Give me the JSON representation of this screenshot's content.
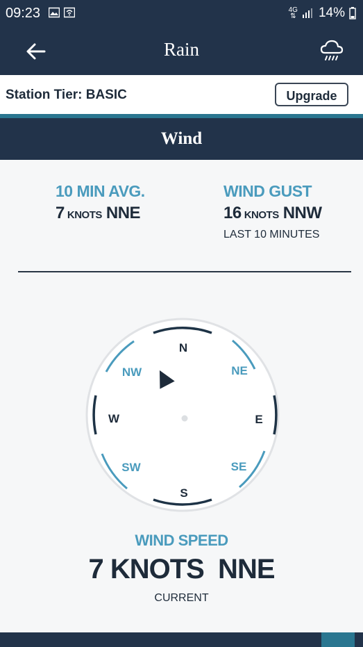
{
  "status_bar": {
    "time": "09:23",
    "network_top": "4G",
    "battery": "14%",
    "icons": [
      "gallery-icon",
      "wifi-icon",
      "signal-icon",
      "battery-icon"
    ]
  },
  "app_bar": {
    "title": "Rain",
    "back_icon": "arrow-left-icon",
    "weather_icon": "rain-cloud-icon"
  },
  "tier": {
    "label": "Station Tier: BASIC",
    "upgrade_label": "Upgrade"
  },
  "section": {
    "title": "Wind"
  },
  "avg": {
    "label": "10 MIN AVG.",
    "value": "7",
    "unit": "KNOTS",
    "direction": "NNE"
  },
  "gust": {
    "label": "WIND GUST",
    "value": "16",
    "unit": "KNOTS",
    "direction": "NNW",
    "sub": "LAST 10 MINUTES"
  },
  "compass": {
    "cardinals": {
      "n": "N",
      "ne": "NE",
      "e": "E",
      "se": "SE",
      "s": "S",
      "sw": "SW",
      "w": "W",
      "nw": "NW"
    },
    "pointer_heading_deg": 22.5
  },
  "wind_speed": {
    "label": "WIND SPEED",
    "value": "7 KNOTS  NNE",
    "sub": "CURRENT"
  },
  "colors": {
    "navy": "#22334a",
    "accent": "#2a7690",
    "light_blue": "#4a9bbd"
  }
}
